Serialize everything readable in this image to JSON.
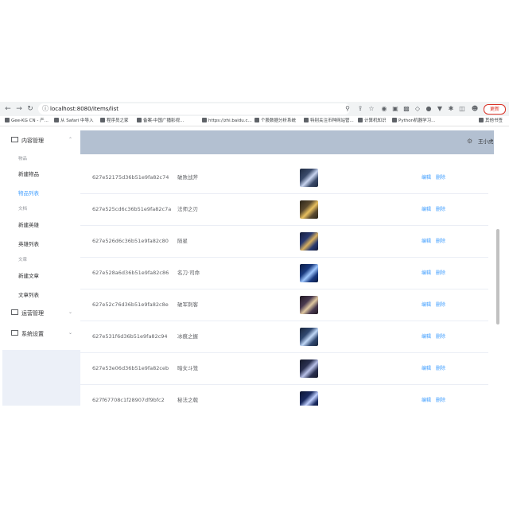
{
  "browser": {
    "url": "localhost:8080/items/list",
    "update_label": "更新",
    "bookmarks": [
      "Gee-KG CN - 产...",
      "从 Safari 中导入",
      "程序员之家",
      "备案-中国广播影视...",
      "https://zhi.baidu.c...",
      "个股数据分析系统",
      "特别关注币种网站管...",
      "计算机知识",
      "Python机器学习...",
      "其他书签"
    ]
  },
  "sidebar": {
    "menus": [
      {
        "label": "内容管理",
        "icon": "mail-icon",
        "expanded": true
      },
      {
        "label": "运营管理",
        "icon": "mail-icon",
        "expanded": false
      },
      {
        "label": "系统设置",
        "icon": "mail-icon",
        "expanded": false
      }
    ],
    "groups": [
      "物品",
      "文档",
      "文章"
    ],
    "items": [
      "新建物品",
      "物品列表",
      "新建英雄",
      "英雄列表",
      "新建文章",
      "文章列表"
    ],
    "active_item": "物品列表",
    "accent_color": "#409eff"
  },
  "header": {
    "user_name": "王小虎",
    "background": "#b3c0d1"
  },
  "table": {
    "rows": [
      {
        "id": "627e52175d36b51e9fa82c74",
        "name": "破败战斧",
        "thumb": [
          "#3a4a6a",
          "#c8d4f0",
          "#1e2a40"
        ],
        "edit": "编辑",
        "delete": "删除"
      },
      {
        "id": "627e525cd6c36b51e9fa82c7a",
        "name": "法师之刃",
        "thumb": [
          "#5a4a30",
          "#e8c060",
          "#2a2418"
        ],
        "edit": "编辑",
        "delete": "删除"
      },
      {
        "id": "627e526d6c36b51e9fa82c80",
        "name": "陨星",
        "thumb": [
          "#2a3a70",
          "#d8b060",
          "#141c3a"
        ],
        "edit": "编辑",
        "delete": "删除"
      },
      {
        "id": "627e528a6d36b51e9fa82c86",
        "name": "名刀·司命",
        "thumb": [
          "#1a3a80",
          "#a0c8ff",
          "#0a1a40"
        ],
        "edit": "编辑",
        "delete": "删除"
      },
      {
        "id": "627e52c76d36b51e9fa82c8e",
        "name": "破军刺客",
        "thumb": [
          "#4a3a50",
          "#e0c8a0",
          "#201820"
        ],
        "edit": "编辑",
        "delete": "删除"
      },
      {
        "id": "627e531f6d36b51e9fa82c94",
        "name": "冰痕之握",
        "thumb": [
          "#304870",
          "#c0d8f8",
          "#18243a"
        ],
        "edit": "编辑",
        "delete": "删除"
      },
      {
        "id": "627e53e06d36b51e9fa82ceb",
        "name": "暗女斗笼",
        "thumb": [
          "#2a3050",
          "#b8c0e8",
          "#141828"
        ],
        "edit": "编辑",
        "delete": "删除"
      },
      {
        "id": "627f67708c1f28907df9bfc2",
        "name": "秘法之戟",
        "thumb": [
          "#1a2a60",
          "#c0d0ff",
          "#0c1430"
        ],
        "edit": "编辑",
        "delete": "删除"
      }
    ]
  }
}
